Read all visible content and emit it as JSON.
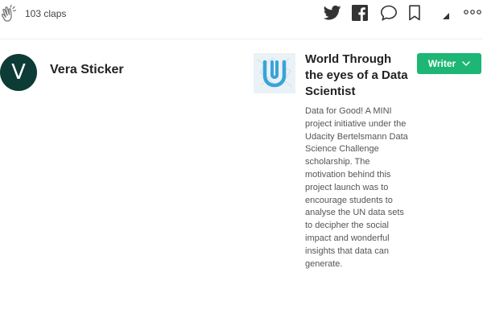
{
  "claps": {
    "count_label": "103 claps",
    "icon": "clap-icon"
  },
  "share_bar": {
    "icons": [
      "twitter-icon",
      "facebook-icon",
      "comment-icon",
      "bookmark-icon",
      "caret-icon",
      "more-icon"
    ]
  },
  "author": {
    "initial": "V",
    "name": "Vera Sticker",
    "avatar_color": "#0d3b35"
  },
  "publication": {
    "logo": "udacity-logo",
    "title": "World Through the eyes of a Data Scientist",
    "description": "Data for Good! A MINI project initiative under the Udacity Bertelsmann Data Science Challenge scholarship. The motivation behind this project launch was to encourage students to analyse the UN data sets to decipher the social impact and wonderful insights that data can generate.",
    "follow_button_label": "Writer",
    "button_color": "#1eb674",
    "logo_color": "#3aa3d8"
  }
}
